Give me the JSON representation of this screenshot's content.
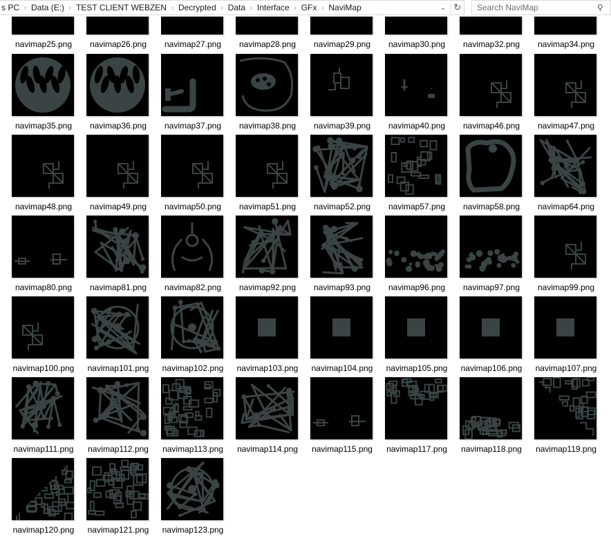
{
  "address_bar": {
    "crumbs": [
      "s PC",
      "Data (E:)",
      "TEST CLIENT WEBZEN",
      "Decrypted",
      "Data",
      "Interface",
      "GFx",
      "NaviMap"
    ],
    "dropdown_icon": "chevron-down-icon",
    "refresh_icon": "refresh-icon"
  },
  "search": {
    "placeholder": "Search NaviMap",
    "value": "",
    "icon": "search-icon"
  },
  "colors": {
    "map_fill": "#3a4444",
    "thumb_bg": "#000000"
  },
  "files": [
    {
      "name": "navimap25.png",
      "pattern": "ushape"
    },
    {
      "name": "navimap26.png",
      "pattern": "ushape"
    },
    {
      "name": "navimap27.png",
      "pattern": "ushape"
    },
    {
      "name": "navimap28.png",
      "pattern": "ushape"
    },
    {
      "name": "navimap29.png",
      "pattern": "ushape"
    },
    {
      "name": "navimap30.png",
      "pattern": "ushape"
    },
    {
      "name": "navimap32.png",
      "pattern": "blobs"
    },
    {
      "name": "navimap34.png",
      "pattern": "blobs"
    },
    {
      "name": "navimap35.png",
      "pattern": "cave"
    },
    {
      "name": "navimap36.png",
      "pattern": "cave"
    },
    {
      "name": "navimap37.png",
      "pattern": "ushape-small"
    },
    {
      "name": "navimap38.png",
      "pattern": "ring"
    },
    {
      "name": "navimap39.png",
      "pattern": "small-center"
    },
    {
      "name": "navimap40.png",
      "pattern": "two-dots"
    },
    {
      "name": "navimap46.png",
      "pattern": "diamond"
    },
    {
      "name": "navimap47.png",
      "pattern": "diamond"
    },
    {
      "name": "navimap48.png",
      "pattern": "diamond"
    },
    {
      "name": "navimap49.png",
      "pattern": "diamond"
    },
    {
      "name": "navimap50.png",
      "pattern": "diamond"
    },
    {
      "name": "navimap51.png",
      "pattern": "diamond"
    },
    {
      "name": "navimap52.png",
      "pattern": "network"
    },
    {
      "name": "navimap57.png",
      "pattern": "maze"
    },
    {
      "name": "navimap58.png",
      "pattern": "cave-open"
    },
    {
      "name": "navimap64.png",
      "pattern": "network"
    },
    {
      "name": "navimap80.png",
      "pattern": "bottom-two"
    },
    {
      "name": "navimap81.png",
      "pattern": "network"
    },
    {
      "name": "navimap82.png",
      "pattern": "tower"
    },
    {
      "name": "navimap92.png",
      "pattern": "network"
    },
    {
      "name": "navimap93.png",
      "pattern": "network"
    },
    {
      "name": "navimap96.png",
      "pattern": "band"
    },
    {
      "name": "navimap97.png",
      "pattern": "band"
    },
    {
      "name": "navimap99.png",
      "pattern": "diamond"
    },
    {
      "name": "navimap100.png",
      "pattern": "diamond-left"
    },
    {
      "name": "navimap101.png",
      "pattern": "ring-big"
    },
    {
      "name": "navimap102.png",
      "pattern": "ring-big"
    },
    {
      "name": "navimap103.png",
      "pattern": "square"
    },
    {
      "name": "navimap104.png",
      "pattern": "square"
    },
    {
      "name": "navimap105.png",
      "pattern": "square"
    },
    {
      "name": "navimap106.png",
      "pattern": "square"
    },
    {
      "name": "navimap107.png",
      "pattern": "square"
    },
    {
      "name": "navimap111.png",
      "pattern": "network"
    },
    {
      "name": "navimap112.png",
      "pattern": "network"
    },
    {
      "name": "navimap113.png",
      "pattern": "grid"
    },
    {
      "name": "navimap114.png",
      "pattern": "network"
    },
    {
      "name": "navimap115.png",
      "pattern": "bottom-two"
    },
    {
      "name": "navimap117.png",
      "pattern": "top-grid"
    },
    {
      "name": "navimap118.png",
      "pattern": "bottom-grid"
    },
    {
      "name": "navimap119.png",
      "pattern": "triangle-tr"
    },
    {
      "name": "navimap120.png",
      "pattern": "triangle-br"
    },
    {
      "name": "navimap121.png",
      "pattern": "grid"
    },
    {
      "name": "navimap123.png",
      "pattern": "ring-big"
    }
  ]
}
